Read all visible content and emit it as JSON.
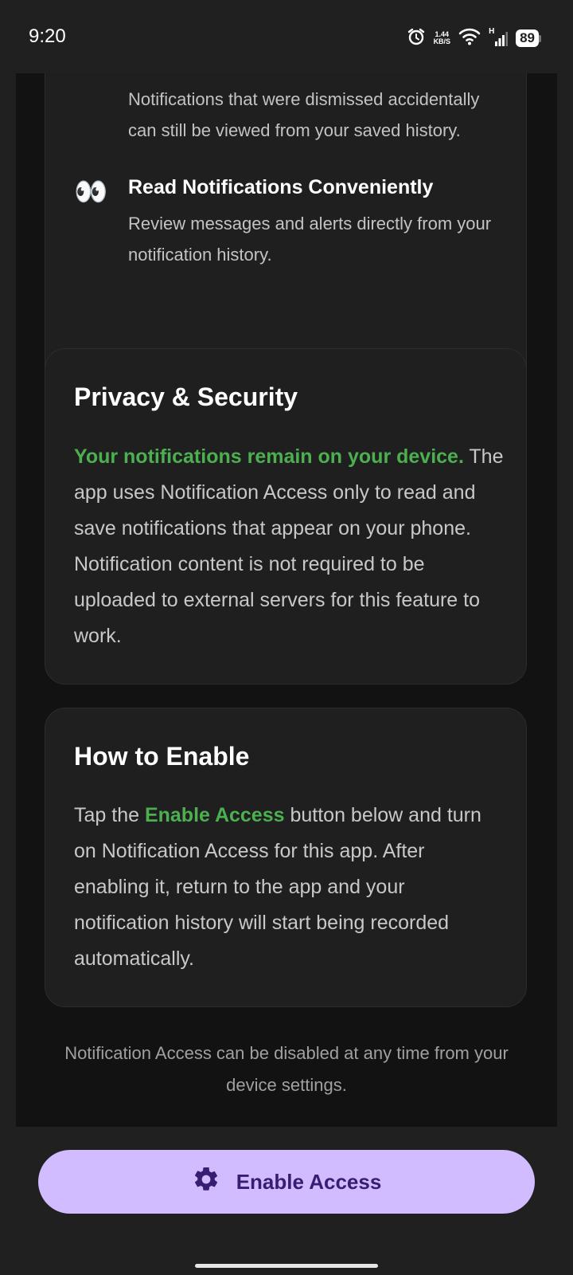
{
  "status": {
    "time": "9:20",
    "net_speed_value": "1.44",
    "net_speed_unit": "KB/S",
    "signal_label": "H",
    "battery": "89"
  },
  "features": {
    "partial_text": "Notifications that were dismissed accidentally can still be viewed from your saved history.",
    "read_title": "Read Notifications Conveniently",
    "read_text": "Review messages and alerts directly from your notification history.",
    "read_icon": "👀"
  },
  "privacy": {
    "title": "Privacy & Security",
    "highlight": "Your notifications remain on your device.",
    "body": " The app uses Notification Access only to read and save notifications that appear on your phone. Notification content is not required to be uploaded to external servers for this feature to work."
  },
  "how_to": {
    "title": "How to Enable",
    "before": "Tap the ",
    "highlight": "Enable Access",
    "after": " button below and turn on Notification Access for this app. After enabling it, return to the app and your notification history will start being recorded automatically."
  },
  "footer_note": "Notification Access can be disabled at any time from your device settings.",
  "button": {
    "label": "Enable Access",
    "icon": "gear-icon"
  },
  "colors": {
    "accent_green": "#4caf50",
    "button_bg": "#d0bcff",
    "button_text": "#381e72"
  }
}
